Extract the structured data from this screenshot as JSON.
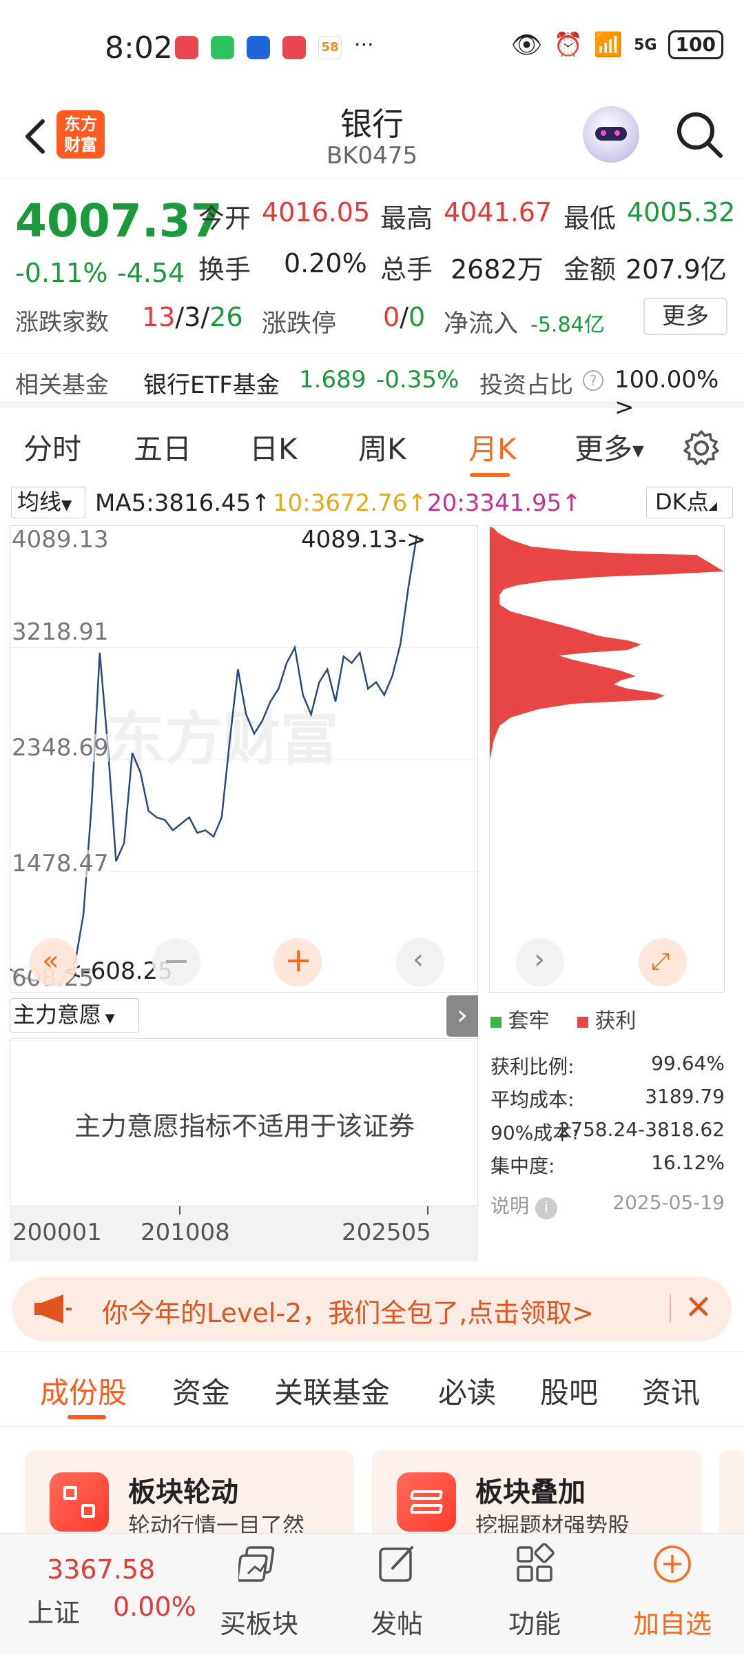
{
  "status_bar": {
    "time": "8:02",
    "more": "···",
    "network": "5G",
    "battery": "100"
  },
  "header": {
    "title": "银行",
    "code": "BK0475",
    "logo_text": "东方财富"
  },
  "quote": {
    "price": "4007.37",
    "change_pct": "-0.11%",
    "change_amt": "-4.54",
    "open_label": "今开",
    "open": "4016.05",
    "high_label": "最高",
    "high": "4041.67",
    "low_label": "最低",
    "low": "4005.32",
    "turnover_label": "换手",
    "turnover": "0.20%",
    "volume_label": "总手",
    "volume": "2682万",
    "amount_label": "金额",
    "amount": "207.9亿",
    "updown_label": "涨跌家数",
    "up": "13",
    "flat": "3",
    "down": "26",
    "sep": "/",
    "limit_label": "涨跌停",
    "limit_up": "0",
    "limit_down": "0",
    "netflow_label": "净流入",
    "netflow": "-5.84亿",
    "more": "更多"
  },
  "fund": {
    "label": "相关基金",
    "name": "银行ETF基金",
    "price": "1.689",
    "change": "-0.35%",
    "ratio_label": "投资占比",
    "ratio": "100.00% >"
  },
  "period_tabs": [
    "分时",
    "五日",
    "日K",
    "周K",
    "月K",
    "更多"
  ],
  "ma": {
    "selector": "均线",
    "ma5": "MA5:3816.45↑",
    "ma10": "10:3672.76↑",
    "ma20": "20:3341.95↑",
    "dk": "DK点"
  },
  "chart_data": {
    "type": "line",
    "title": "",
    "y_ticks": [
      "4089.13",
      "3218.91",
      "2348.69",
      "1478.47",
      "608.25"
    ],
    "max_label": "4089.13->",
    "min_label": "<-608.25",
    "watermark": "东方财富",
    "x_ticks": [
      "200001",
      "201008",
      "202505"
    ],
    "ylim": [
      608.25,
      4089.13
    ],
    "x": [
      "2000-01",
      "2001-01",
      "2002-01",
      "2003-01",
      "2004-01",
      "2005-01",
      "2005-06",
      "2006-01",
      "2006-06",
      "2006-12",
      "2007-06",
      "2007-10",
      "2008-04",
      "2008-10",
      "2009-02",
      "2009-07",
      "2009-12",
      "2010-06",
      "2010-12",
      "2011-06",
      "2011-12",
      "2012-06",
      "2012-12",
      "2013-06",
      "2013-12",
      "2014-06",
      "2014-10",
      "2015-01",
      "2015-05",
      "2015-09",
      "2016-01",
      "2016-06",
      "2016-12",
      "2017-06",
      "2017-12",
      "2018-01",
      "2018-06",
      "2018-12",
      "2019-06",
      "2019-12",
      "2020-06",
      "2020-12",
      "2021-06",
      "2021-12",
      "2022-06",
      "2022-12",
      "2023-06",
      "2023-12",
      "2024-06",
      "2024-12",
      "2025-05"
    ],
    "series": [
      {
        "values": [
          720,
          680,
          650,
          630,
          660,
          620,
          608,
          700,
          780,
          1150,
          2000,
          3180,
          2450,
          1560,
          1700,
          2400,
          2250,
          1950,
          1900,
          1880,
          1800,
          1850,
          1900,
          1780,
          1800,
          1750,
          1900,
          2500,
          3050,
          2700,
          2550,
          2650,
          2800,
          2900,
          3100,
          3220,
          2850,
          2700,
          2950,
          3050,
          2800,
          3150,
          3100,
          3180,
          2900,
          2950,
          2850,
          3000,
          3250,
          3700,
          4089.13
        ]
      }
    ]
  },
  "chip_chart": {
    "legend_trapped": "套牢",
    "legend_profit": "获利",
    "profit_ratio_label": "获利比例:",
    "profit_ratio": "99.64%",
    "avg_cost_label": "平均成本:",
    "avg_cost": "3189.79",
    "cost90_label": "90%成本:",
    "cost90": "2758.24-3818.62",
    "concentration_label": "集中度:",
    "concentration": "16.12%",
    "note_label": "说明",
    "date": "2025-05-19"
  },
  "indicator": {
    "selector": "主力意愿",
    "message": "主力意愿指标不适用于该证券"
  },
  "promo": {
    "text": "你今年的Level-2，我们全包了,点击领取>"
  },
  "section_tabs": [
    "成份股",
    "资金",
    "关联基金",
    "必读",
    "股吧",
    "资讯"
  ],
  "cards": [
    {
      "title": "板块轮动",
      "subtitle": "轮动行情一目了然"
    },
    {
      "title": "板块叠加",
      "subtitle": "挖掘题材强势股"
    }
  ],
  "bottom_bar": {
    "index_value": "3367.58",
    "index_name": "上证",
    "index_change": "0.00%",
    "buy": "买板块",
    "post": "发帖",
    "func": "功能",
    "add": "加自选"
  },
  "colors": {
    "accent": "#ff6a1a",
    "up": "#e53935",
    "down": "#1a9a3a",
    "chip": "#e84545",
    "line": "#2b4a7a"
  }
}
